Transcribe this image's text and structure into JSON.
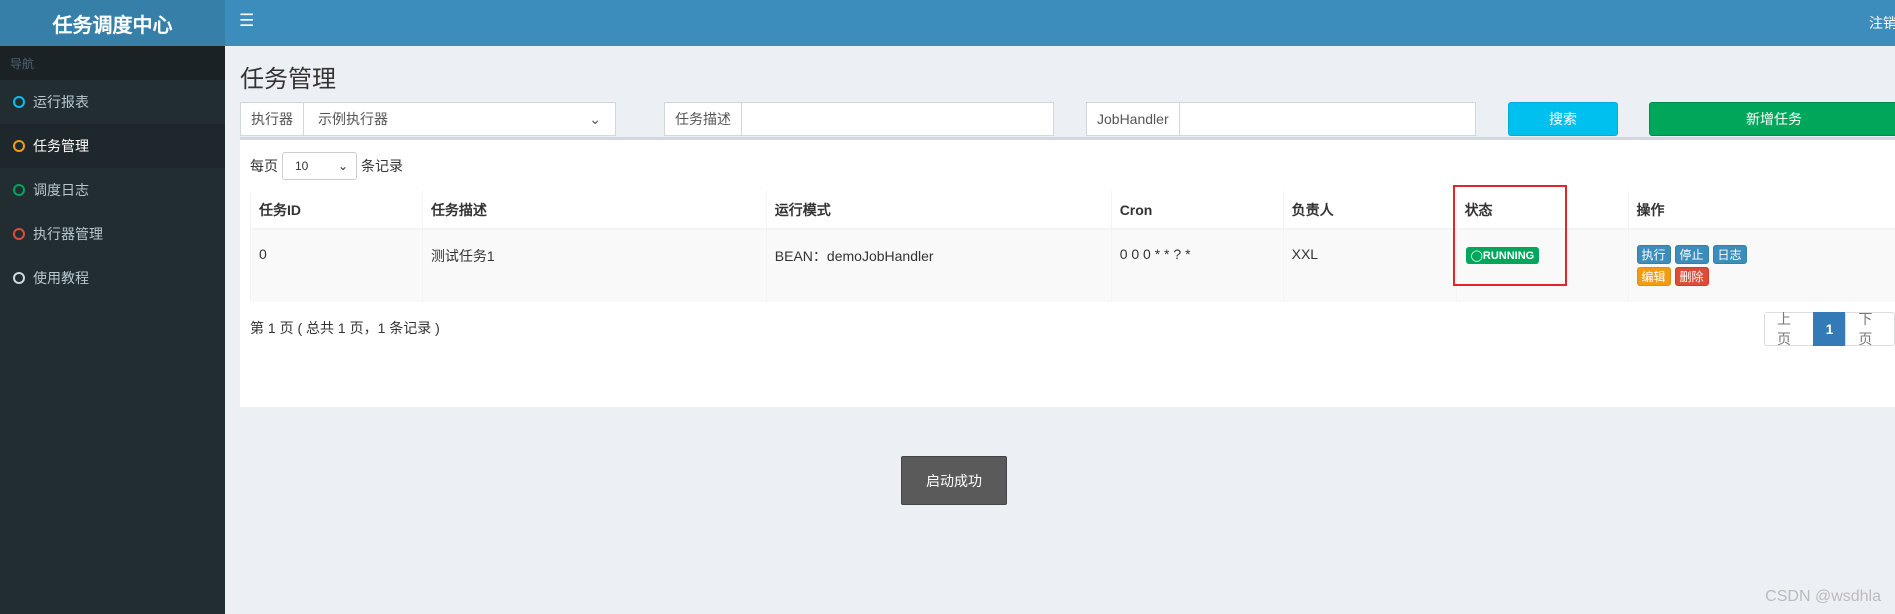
{
  "sidebar": {
    "logo": "任务调度中心",
    "nav_header": "导航",
    "items": [
      {
        "label": "运行报表",
        "color": "#00c0ef"
      },
      {
        "label": "任务管理",
        "color": "#f39c12"
      },
      {
        "label": "调度日志",
        "color": "#00a65a"
      },
      {
        "label": "执行器管理",
        "color": "#dd4b39"
      },
      {
        "label": "使用教程",
        "color": "#d2d6de"
      }
    ]
  },
  "header": {
    "logout": "注销"
  },
  "page": {
    "title": "任务管理"
  },
  "filters": {
    "executor_label": "执行器",
    "executor_value": "示例执行器",
    "desc_label": "任务描述",
    "desc_value": "",
    "handler_label": "JobHandler",
    "handler_value": "",
    "search_button": "搜索",
    "add_button": "新增任务"
  },
  "list": {
    "perpage_prefix": "每页",
    "perpage_value": "10",
    "perpage_suffix": "条记录",
    "columns": [
      "任务ID",
      "任务描述",
      "运行模式",
      "Cron",
      "负责人",
      "状态",
      "操作"
    ],
    "rows": [
      {
        "id": "0",
        "desc": "测试任务1",
        "mode": "BEAN：demoJobHandler",
        "cron": "0 0 0 * * ? *",
        "owner": "XXL",
        "status": "RUNNING",
        "ops": {
          "run": "执行",
          "stop": "停止",
          "log": "日志",
          "edit": "编辑",
          "delete": "删除"
        }
      }
    ],
    "page_info": "第 1 页 ( 总共 1 页，1 条记录 )",
    "pager": {
      "prev": "上页",
      "current": "1",
      "next": "下页"
    }
  },
  "toast": "启动成功",
  "watermark": "CSDN @wsdhla"
}
